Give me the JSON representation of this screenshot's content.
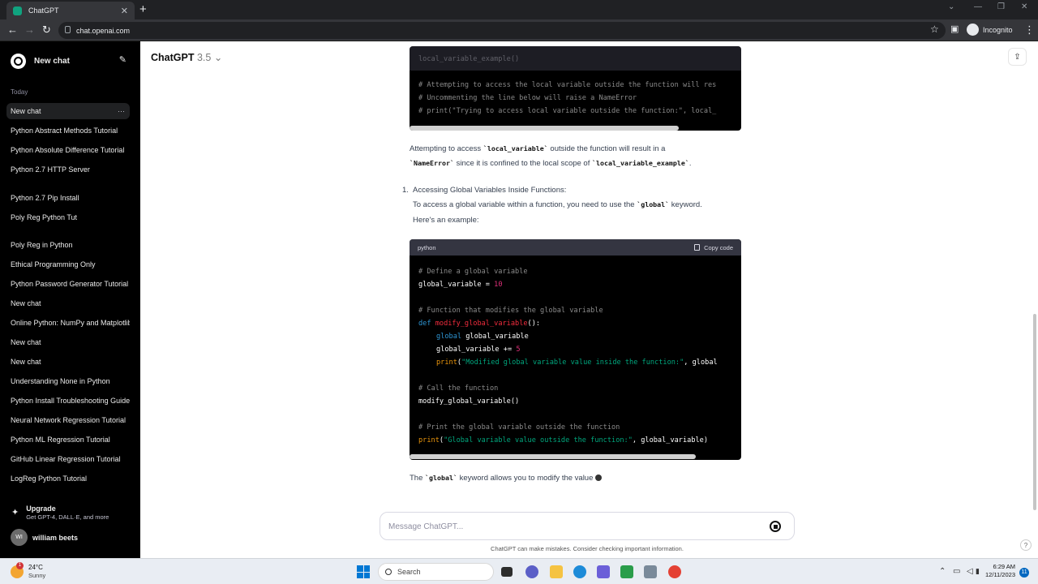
{
  "browser": {
    "tab_title": "ChatGPT",
    "url": "chat.openai.com",
    "profile_label": "Incognito"
  },
  "sidebar": {
    "new_chat_label": "New chat",
    "section_today": "Today",
    "items": [
      {
        "label": "New chat",
        "active": true
      },
      {
        "label": "Python Abstract Methods Tutorial"
      },
      {
        "label": "Python Absolute Difference Tutorial"
      },
      {
        "label": "Python 2.7 HTTP Server"
      },
      {
        "label": "Python 2.7 Pip Install"
      },
      {
        "label": "Poly Reg Python Tut"
      },
      {
        "label": "Poly Reg in Python"
      },
      {
        "label": "Ethical Programming Only"
      },
      {
        "label": "Python Password Generator Tutorial"
      },
      {
        "label": "New chat"
      },
      {
        "label": "Online Python: NumPy and Matplotlib"
      },
      {
        "label": "New chat"
      },
      {
        "label": "New chat"
      },
      {
        "label": "Understanding None in Python"
      },
      {
        "label": "Python Install Troubleshooting Guide"
      },
      {
        "label": "Neural Network Regression Tutorial"
      },
      {
        "label": "Python ML Regression Tutorial"
      },
      {
        "label": "GitHub Linear Regression Tutorial"
      },
      {
        "label": "LogReg Python Tutorial"
      }
    ],
    "upgrade_title": "Upgrade",
    "upgrade_subtitle": "Get GPT-4, DALL·E, and more",
    "user_initials": "WI",
    "user_name": "william beets"
  },
  "main": {
    "model_name": "ChatGPT",
    "model_version": "3.5",
    "code_block_1": {
      "partial_line": "local_variable_example()",
      "lines": [
        "# Attempting to access the local variable outside the function will res",
        "# Uncommenting the line below will raise a NameError",
        "# print(\"Trying to access local variable outside the function:\", local_"
      ]
    },
    "para1": {
      "a": "Attempting to access ",
      "b": "`local_variable`",
      "c": " outside the function will result in a",
      "d": "`NameError`",
      "e": " since it is confined to the local scope of ",
      "f": "`local_variable_example`",
      "g": "."
    },
    "list_item": {
      "number": "1.",
      "heading": "Accessing Global Variables Inside Functions:",
      "line1a": "To access a global variable within a function, you need to use the ",
      "line1b": "`global`",
      "line1c": " keyword.",
      "line2": "Here's an example:"
    },
    "code_block_2": {
      "language": "python",
      "copy_label": "Copy code",
      "lines": {
        "l1": "# Define a global variable",
        "l2a": "global_variable = ",
        "l2b": "10",
        "l3": "# Function that modifies the global variable",
        "l4a": "def",
        "l4b": "modify_global_variable",
        "l4c": "():",
        "l5a": "global",
        "l5b": " global_variable",
        "l6a": "global_variable += ",
        "l6b": "5",
        "l7a": "print",
        "l7b": "(",
        "l7c": "\"Modified global variable value inside the function:\"",
        "l7d": ", global",
        "l8": "# Call the function",
        "l9": "modify_global_variable()",
        "l10": "# Print the global variable outside the function",
        "l11a": "print",
        "l11b": "(",
        "l11c": "\"Global variable value outside the function:\"",
        "l11d": ", global_variable)"
      }
    },
    "para2": {
      "a": "The ",
      "b": "`global`",
      "c": " keyword allows you to modify the value"
    },
    "message_placeholder": "Message ChatGPT...",
    "disclaimer": "ChatGPT can make mistakes. Consider checking important information.",
    "help_label": "?"
  },
  "taskbar": {
    "temperature": "24°C",
    "condition": "Sunny",
    "weather_badge": "1",
    "search_label": "Search",
    "time": "6:29 AM",
    "date": "12/11/2023",
    "notification_count": "11"
  }
}
